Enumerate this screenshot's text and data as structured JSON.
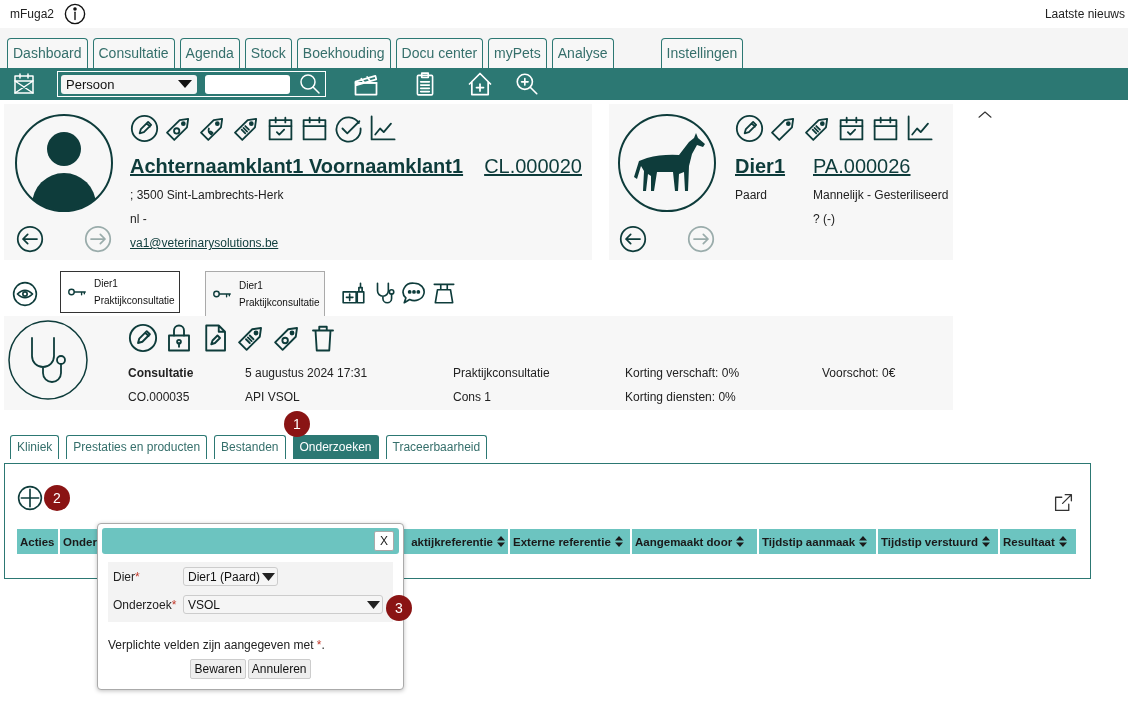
{
  "app": {
    "title": "mFuga2",
    "news": "Laatste nieuws"
  },
  "main_tabs": [
    "Dashboard",
    "Consultatie",
    "Agenda",
    "Stock",
    "Boekhouding",
    "Docu center",
    "myPets",
    "Analyse",
    "Instellingen"
  ],
  "toolbar": {
    "search_type": "Persoon"
  },
  "client": {
    "name": "Achternaamklant1 Voornaamklant1",
    "number": "CL.000020",
    "address": "; 3500 Sint-Lambrechts-Herk",
    "language": "nl -",
    "email": "va1@veterinarysolutions.be",
    "previous_disabled": false,
    "next_disabled": true
  },
  "patient": {
    "name": "Dier1",
    "number": "PA.000026",
    "species": "Paard",
    "sex": "Mannelijk - Gesteriliseerd",
    "age": "? (-)",
    "previous_disabled": false,
    "next_disabled": true
  },
  "consultation_tabs": [
    {
      "animal": "Dier1",
      "type": "Praktijkconsultatie",
      "selected": false
    },
    {
      "animal": "Dier1",
      "type": "Praktijkconsultatie",
      "selected": true
    }
  ],
  "consultation": {
    "title": "Consultatie",
    "number": "CO.000035",
    "date": "5 augustus 2024 17:31",
    "author": "API VSOL",
    "type": "Praktijkconsultatie",
    "name": "Cons 1",
    "discount_given": "Korting verschaft: 0%",
    "discount_services": "Korting diensten: 0%",
    "deposit": "Voorschot: 0€"
  },
  "sub_tabs": [
    {
      "label": "Kliniek",
      "selected": false
    },
    {
      "label": "Prestaties en producten",
      "selected": false
    },
    {
      "label": "Bestanden",
      "selected": false
    },
    {
      "label": "Onderzoeken",
      "selected": true
    },
    {
      "label": "Traceerbaarheid",
      "selected": false
    }
  ],
  "callouts": [
    "1",
    "2",
    "3"
  ],
  "table": {
    "columns": [
      {
        "label": "Acties"
      },
      {
        "label": "Onder"
      },
      {
        "label": "aktijkreferentie",
        "sortable": true
      },
      {
        "label": "Externe referentie",
        "sortable": true
      },
      {
        "label": "Aangemaakt door",
        "sortable": true
      },
      {
        "label": "Tijdstip aanmaak",
        "sortable": true
      },
      {
        "label": "Tijdstip verstuurd",
        "sortable": true
      },
      {
        "label": "Resultaat",
        "sortable": true
      }
    ]
  },
  "dialog": {
    "close": "X",
    "fields": [
      {
        "label": "Dier",
        "required_mark": "*",
        "value": "Dier1 (Paard)",
        "kind": "short"
      },
      {
        "label": "Onderzoek",
        "required_mark": "*",
        "value": "VSOL",
        "kind": "wide"
      }
    ],
    "note": {
      "text": "Verplichte velden zijn aangegeven met ",
      "mark": "*",
      "end": "."
    },
    "buttons": [
      "Bewaren",
      "Annuleren"
    ]
  }
}
